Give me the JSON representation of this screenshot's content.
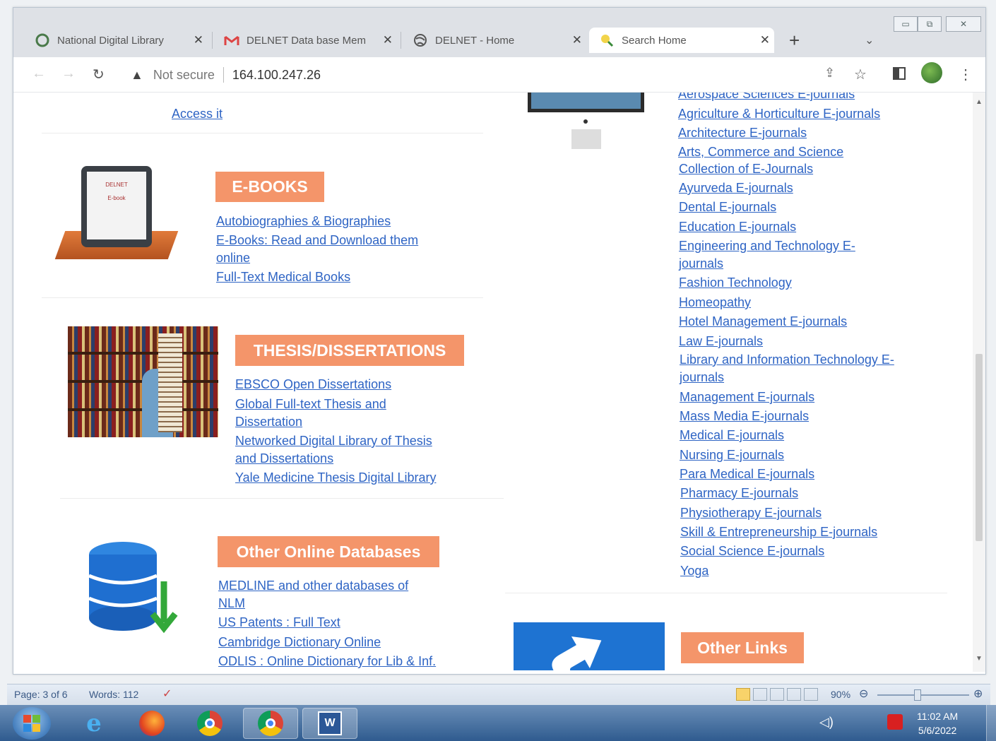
{
  "browser": {
    "tabs": [
      {
        "title": "National Digital Library",
        "icon": "globe-icon"
      },
      {
        "title": "DELNET Data base Mem",
        "icon": "gmail-icon"
      },
      {
        "title": "DELNET - Home",
        "icon": "globe-icon"
      },
      {
        "title": "Search Home",
        "icon": "search-home-icon"
      }
    ],
    "new_tab": "+",
    "security": "Not secure",
    "url": "164.100.247.26"
  },
  "left": {
    "access_link": "Access it",
    "ebooks": {
      "badge": "E-BOOKS",
      "screen_logo": "DELNET",
      "screen_label": "E-book",
      "links": [
        "Autobiographies & Biographies",
        "E-Books: Read and Download them",
        "online",
        "Full-Text Medical Books"
      ]
    },
    "thesis": {
      "badge": "THESIS/DISSERTATIONS",
      "links": [
        "EBSCO Open Dissertations",
        "Global Full-text Thesis and",
        "Dissertation",
        "Networked Digital Library of Thesis",
        "and Dissertations",
        "Yale Medicine Thesis Digital Library"
      ]
    },
    "other": {
      "badge": "Other Online Databases",
      "links": [
        "MEDLINE and other databases of",
        "NLM",
        "US Patents : Full Text",
        "Cambridge Dictionary Online",
        "ODLIS : Online Dictionary for Lib & Inf."
      ]
    }
  },
  "right": {
    "journals": [
      "Aerospace Sciences E-journals",
      "Agriculture & Horticulture E-journals",
      "Architecture E-journals",
      "Arts, Commerce and Science",
      "Collection of E-Journals",
      "Ayurveda E-journals",
      "Dental E-journals",
      "Education E-journals",
      "Engineering and Technology E-",
      "journals",
      "Fashion Technology",
      "Homeopathy",
      "Hotel Management E-journals",
      "Law E-journals",
      "Library and Information Technology E-",
      "journals",
      "Management E-journals",
      "Mass Media E-journals",
      "Medical E-journals",
      "Nursing E-journals",
      "Para Medical E-journals",
      "Pharmacy E-journals",
      "Physiotherapy E-journals",
      "Skill & Entrepreneurship E-journals",
      "Social Science E-journals",
      "Yoga"
    ],
    "other_links_badge": "Other Links"
  },
  "word_status": {
    "page": "Page: 3 of 6",
    "words": "Words: 112",
    "zoom": "90%"
  },
  "clock": {
    "time": "11:02 AM",
    "date": "5/6/2022"
  },
  "colors": {
    "badge": "#f4956a",
    "link": "#2e64c4"
  }
}
